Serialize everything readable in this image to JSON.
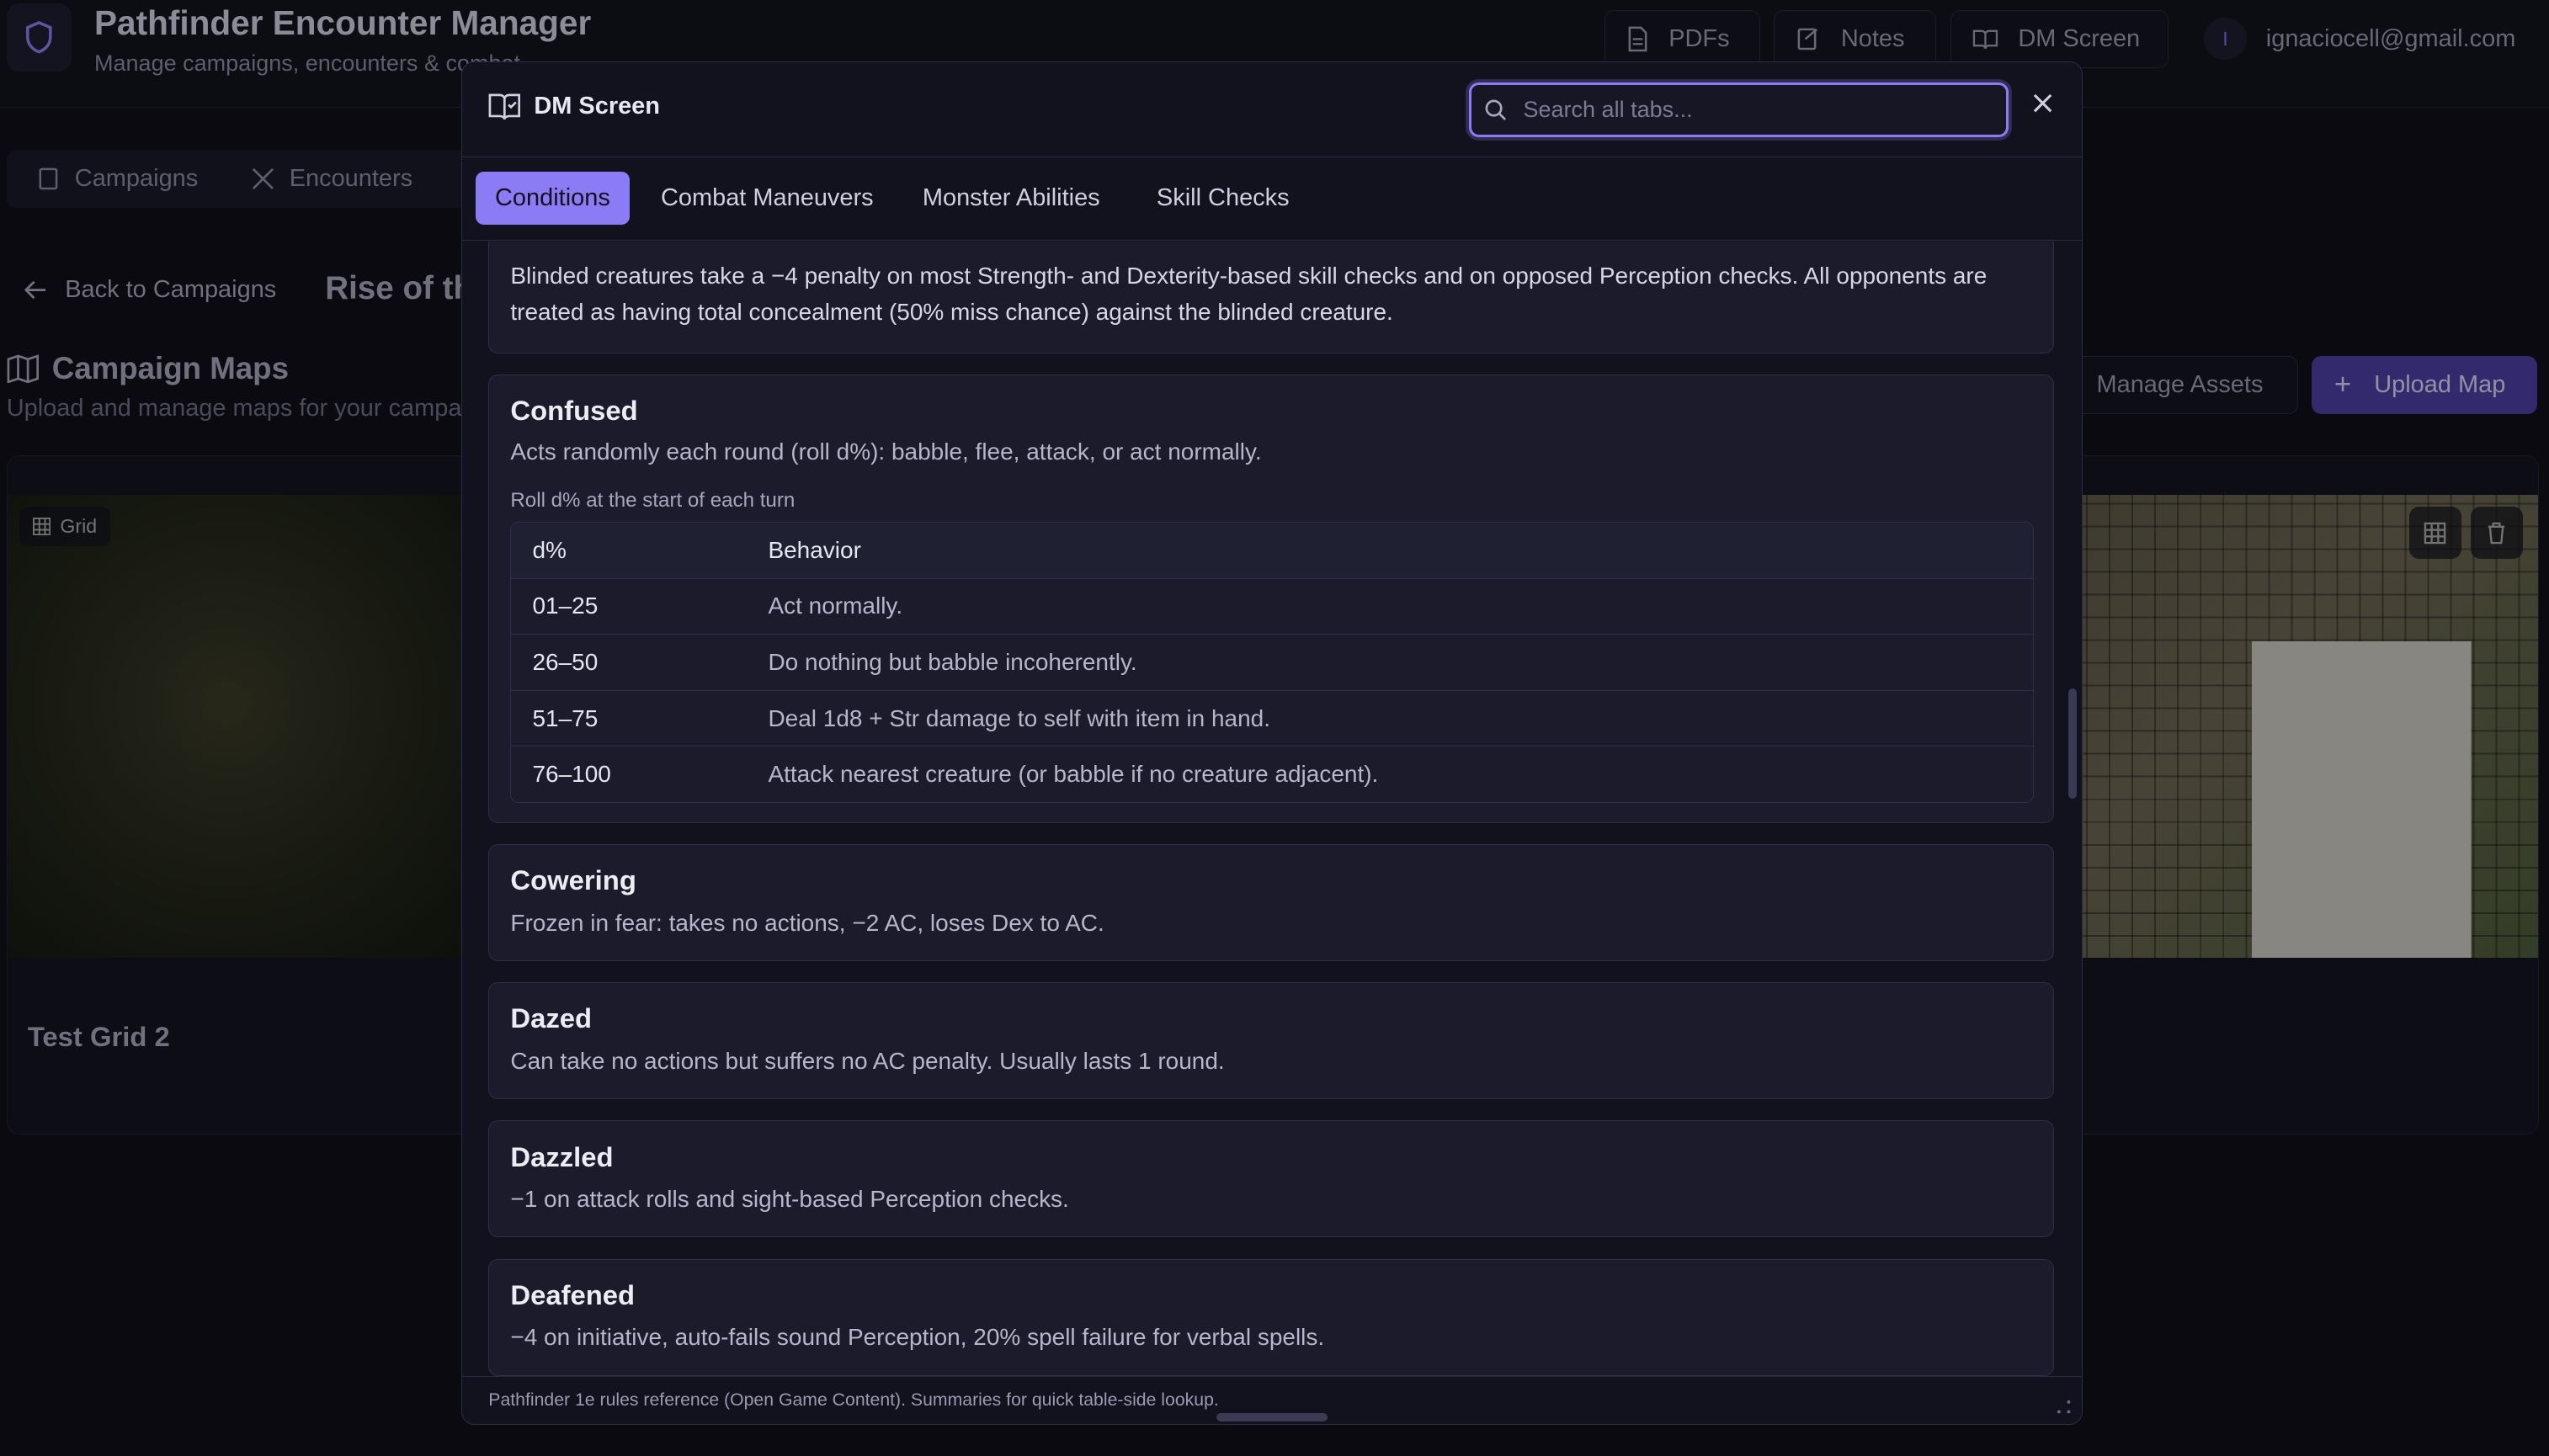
{
  "app": {
    "title": "Pathfinder Encounter Manager",
    "subtitle": "Manage campaigns, encounters & combat",
    "header_buttons": [
      {
        "label": "PDFs",
        "icon": "document-icon"
      },
      {
        "label": "Notes",
        "icon": "notebook-icon"
      },
      {
        "label": "DM Screen",
        "icon": "book-check-icon"
      }
    ],
    "user": {
      "initial": "I",
      "email": "ignaciocell@gmail.com"
    }
  },
  "nav": {
    "campaigns": "Campaigns",
    "encounters": "Encounters"
  },
  "page": {
    "back_label": "Back to Campaigns",
    "campaign_title": "Rise of th",
    "maps_title": "Campaign Maps",
    "maps_subtitle": "Upload and manage maps for your campai",
    "manage_assets": "Manage Assets",
    "upload_map": "Upload Map",
    "grid_chip": "Grid",
    "map_name": "Test Grid 2"
  },
  "modal": {
    "title": "DM Screen",
    "search_placeholder": "Search all tabs...",
    "tabs": [
      "Conditions",
      "Combat Maneuvers",
      "Monster Abilities",
      "Skill Checks"
    ],
    "active_tab": "Conditions",
    "footer": "Pathfinder 1e rules reference (Open Game Content). Summaries for quick table-side lookup."
  },
  "conditions": {
    "blinded_desc": "Blinded creatures take a −4 penalty on most Strength- and Dexterity-based skill checks and on opposed Perception checks. All opponents are treated as having total concealment (50% miss chance) against the blinded creature.",
    "confused": {
      "name": "Confused",
      "desc": "Acts randomly each round (roll d%): babble, flee, attack, or act normally.",
      "table_caption": "Roll d% at the start of each turn",
      "headers": [
        "d%",
        "Behavior"
      ],
      "rows": [
        [
          "01–25",
          "Act normally."
        ],
        [
          "26–50",
          "Do nothing but babble incoherently."
        ],
        [
          "51–75",
          "Deal 1d8 + Str damage to self with item in hand."
        ],
        [
          "76–100",
          "Attack nearest creature (or babble if no creature adjacent)."
        ]
      ]
    },
    "cowering": {
      "name": "Cowering",
      "desc": "Frozen in fear: takes no actions, −2 AC, loses Dex to AC."
    },
    "dazed": {
      "name": "Dazed",
      "desc": "Can take no actions but suffers no AC penalty. Usually lasts 1 round."
    },
    "dazzled": {
      "name": "Dazzled",
      "desc": "−1 on attack rolls and sight-based Perception checks."
    },
    "deafened": {
      "name": "Deafened",
      "desc": "−4 on initiative, auto-fails sound Perception, 20% spell failure for verbal spells."
    }
  },
  "colors": {
    "accent": "#8b7cf5",
    "background": "#0f0f18",
    "card": "#1b1b2c"
  }
}
